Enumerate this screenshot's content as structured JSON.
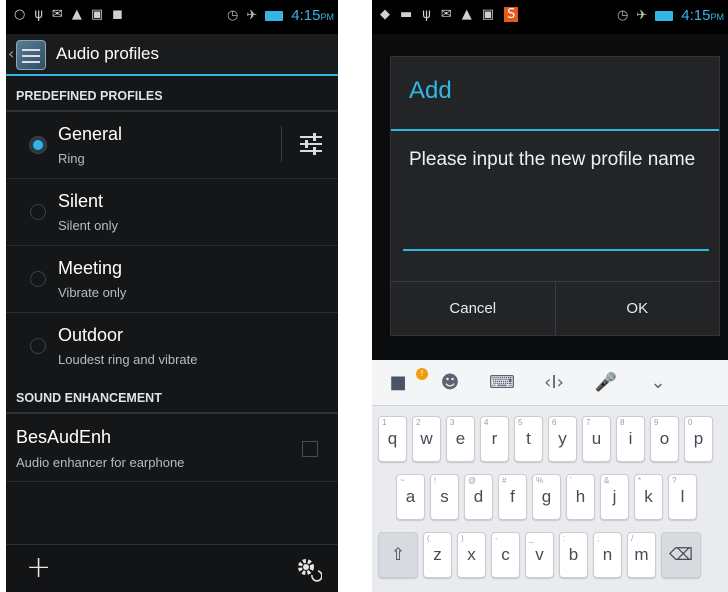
{
  "left_screen": {
    "status_bar": {
      "icons": [
        "circle-icon",
        "usb-icon",
        "mail-icon",
        "warning-icon",
        "chat-icon",
        "game-icon",
        "alarm-icon",
        "airplane-icon",
        "battery-icon"
      ],
      "time": "4:15",
      "ampm": "PM"
    },
    "action_bar": {
      "title": "Audio profiles"
    },
    "predefined_header": "PREDEFINED PROFILES",
    "profiles": [
      {
        "name": "General",
        "subtitle": "Ring",
        "selected": true
      },
      {
        "name": "Silent",
        "subtitle": "Silent only",
        "selected": false
      },
      {
        "name": "Meeting",
        "subtitle": "Vibrate only",
        "selected": false
      },
      {
        "name": "Outdoor",
        "subtitle": "Loudest ring and vibrate",
        "selected": false
      }
    ],
    "sound_header": "SOUND ENHANCEMENT",
    "enhancement": {
      "name": "BesAudEnh",
      "subtitle": "Audio enhancer for earphone",
      "checked": false
    },
    "bottom_bar": {
      "add_icon": "+",
      "settings_icon": "gear-refresh-icon"
    }
  },
  "right_screen": {
    "status_bar": {
      "time": "4:15",
      "ampm": "PM"
    },
    "dialog": {
      "title": "Add",
      "message": "Please input the new profile name",
      "input_value": "",
      "cancel_label": "Cancel",
      "ok_label": "OK"
    },
    "keyboard": {
      "toolbar": [
        "apps-icon",
        "emoji-icon",
        "keyboard-icon",
        "cursor-icon",
        "mic-icon",
        "collapse-icon"
      ],
      "row1": [
        {
          "k": "q",
          "s": "1"
        },
        {
          "k": "w",
          "s": "2"
        },
        {
          "k": "e",
          "s": "3"
        },
        {
          "k": "r",
          "s": "4"
        },
        {
          "k": "t",
          "s": "5"
        },
        {
          "k": "y",
          "s": "6"
        },
        {
          "k": "u",
          "s": "7"
        },
        {
          "k": "i",
          "s": "8"
        },
        {
          "k": "o",
          "s": "9"
        },
        {
          "k": "p",
          "s": "0"
        }
      ],
      "row2": [
        {
          "k": "a",
          "s": "~"
        },
        {
          "k": "s",
          "s": "!"
        },
        {
          "k": "d",
          "s": "@"
        },
        {
          "k": "f",
          "s": "#"
        },
        {
          "k": "g",
          "s": "%"
        },
        {
          "k": "h",
          "s": "'"
        },
        {
          "k": "j",
          "s": "&"
        },
        {
          "k": "k",
          "s": "*"
        },
        {
          "k": "l",
          "s": "?"
        }
      ],
      "row3": [
        {
          "k": "z",
          "s": "("
        },
        {
          "k": "x",
          "s": ")"
        },
        {
          "k": "c",
          "s": "-"
        },
        {
          "k": "v",
          "s": "_"
        },
        {
          "k": "b",
          "s": ":"
        },
        {
          "k": "n",
          "s": ";"
        },
        {
          "k": "m",
          "s": "/"
        }
      ],
      "shift_icon": "⇧",
      "backspace_icon": "⌫"
    }
  },
  "colors": {
    "accent": "#33b5e5",
    "dark_bg": "#151617",
    "keyboard_bg": "#e9ebee"
  }
}
